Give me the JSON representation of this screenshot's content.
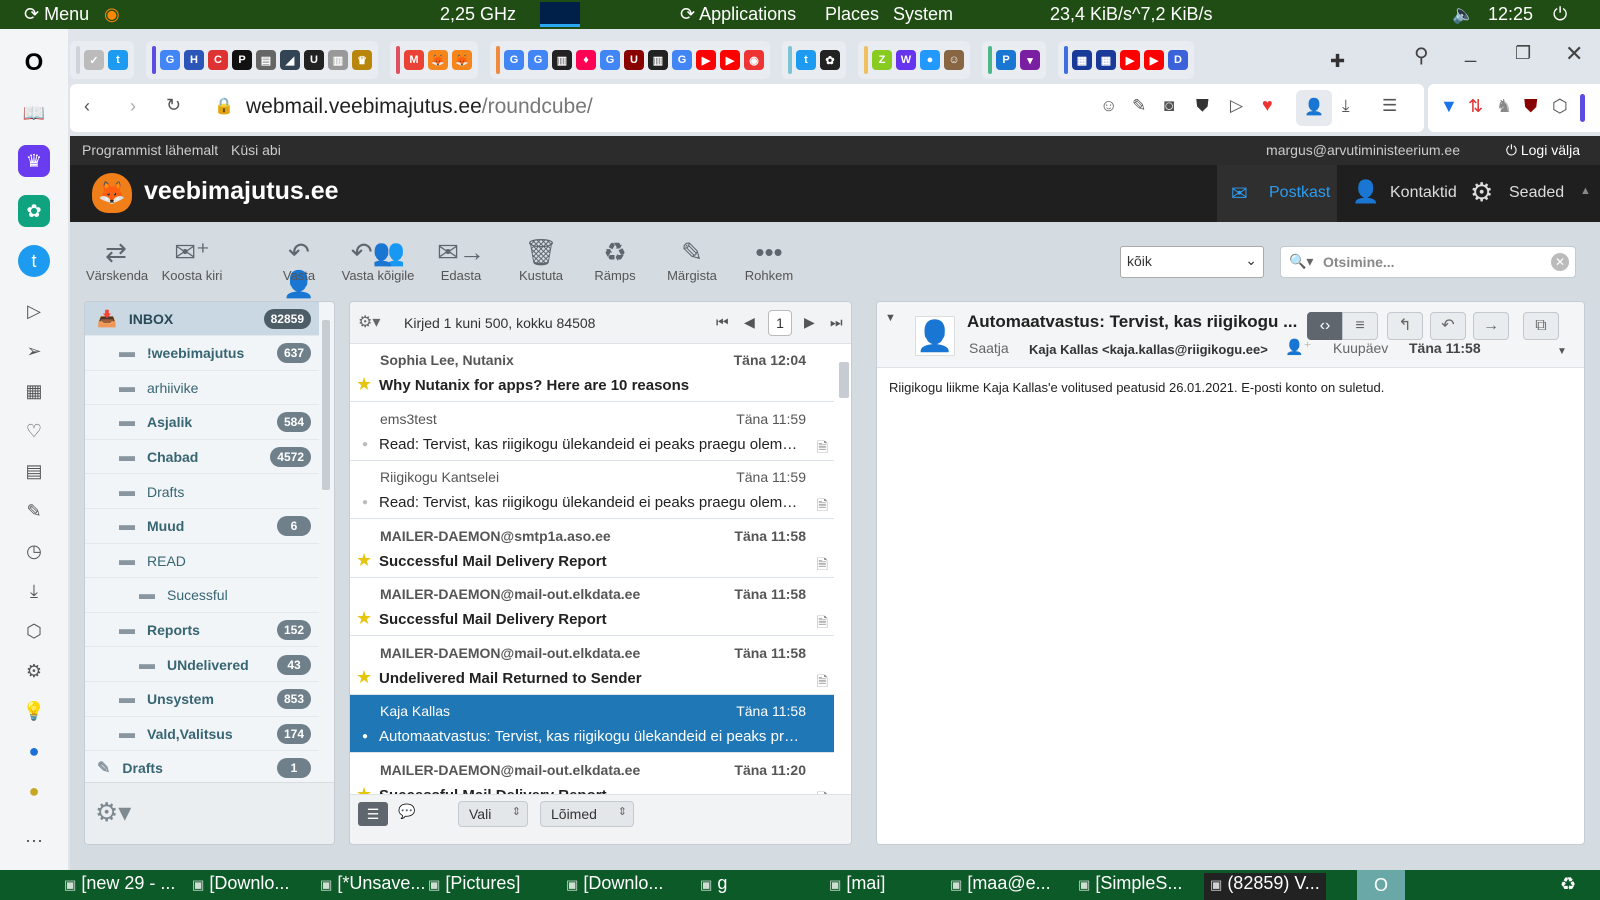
{
  "top_panel": {
    "menu": "Menu",
    "cpu": "2,25 GHz",
    "applications": "Applications",
    "places": "Places",
    "system": "System",
    "net": "23,4 KiB/s^7,2 KiB/s",
    "clock": "12:25"
  },
  "browser": {
    "url_host": "webmail.veebimajutus.ee",
    "url_path": "/roundcube/",
    "tab_groups": [
      {
        "color": "#d0d4d8",
        "favs": [
          {
            "l": "✓",
            "c": "#bbb"
          },
          {
            "l": "t",
            "c": "#1d9bf0"
          }
        ]
      },
      {
        "color": "#5b4de0",
        "favs": [
          {
            "l": "G",
            "c": "#4285f4"
          },
          {
            "l": "H",
            "c": "#2b55b8"
          },
          {
            "l": "C",
            "c": "#d33"
          },
          {
            "l": "P",
            "c": "#111"
          },
          {
            "l": "▤",
            "c": "#666"
          },
          {
            "l": "◢",
            "c": "#345"
          },
          {
            "l": "U",
            "c": "#222"
          },
          {
            "l": "▥",
            "c": "#999"
          },
          {
            "l": "♛",
            "c": "#b8860b"
          }
        ]
      },
      {
        "color": "#e0505e",
        "favs": [
          {
            "l": "M",
            "c": "#ea4335"
          },
          {
            "l": "🦊",
            "c": "#f6851b"
          },
          {
            "l": "🦊",
            "c": "#f6851b"
          }
        ]
      },
      {
        "color": "#f08a3c",
        "favs": [
          {
            "l": "G",
            "c": "#4285f4"
          },
          {
            "l": "G",
            "c": "#4285f4"
          },
          {
            "l": "▥",
            "c": "#222"
          },
          {
            "l": "♦",
            "c": "#f05"
          },
          {
            "l": "G",
            "c": "#4285f4"
          },
          {
            "l": "U",
            "c": "#800"
          },
          {
            "l": "▥",
            "c": "#222"
          },
          {
            "l": "G",
            "c": "#4285f4"
          },
          {
            "l": "▶",
            "c": "#f00"
          },
          {
            "l": "▶",
            "c": "#f00"
          },
          {
            "l": "◉",
            "c": "#e33"
          }
        ]
      },
      {
        "color": "#7cc4d4",
        "favs": [
          {
            "l": "t",
            "c": "#1d9bf0"
          },
          {
            "l": "✿",
            "c": "#222"
          }
        ]
      },
      {
        "color": "#f0c060",
        "favs": [
          {
            "l": "Z",
            "c": "#8c2"
          },
          {
            "l": "W",
            "c": "#63e"
          },
          {
            "l": "●",
            "c": "#29f"
          },
          {
            "l": "☺",
            "c": "#864"
          }
        ]
      },
      {
        "color": "#4cb88a",
        "favs": [
          {
            "l": "P",
            "c": "#1976d2"
          },
          {
            "l": "▾",
            "c": "#7b1fa2"
          }
        ]
      },
      {
        "color": "#3c6ee0",
        "favs": [
          {
            "l": "▦",
            "c": "#1a3a9a"
          },
          {
            "l": "▦",
            "c": "#1a3a9a"
          },
          {
            "l": "▶",
            "c": "#f00"
          },
          {
            "l": "▶",
            "c": "#f00"
          },
          {
            "l": "D",
            "c": "#3b62d8"
          }
        ]
      }
    ]
  },
  "roundcube": {
    "top_links": [
      "Programmist lähemalt",
      "Küsi abi"
    ],
    "user": "margus@arvutiministeerium.ee",
    "logout": "Logi välja",
    "logo": "veebimajutus.ee",
    "nav": {
      "mail": "Postkast",
      "contacts": "Kontaktid",
      "settings": "Seaded"
    },
    "toolbar": [
      "Värskenda",
      "Koosta kiri",
      "Vasta",
      "Vasta kõigile",
      "Edasta",
      "Kustuta",
      "Rämps",
      "Märgista",
      "Rohkem"
    ],
    "search_scope": "kõik",
    "search_placeholder": "Otsimine...",
    "folders": [
      {
        "name": "INBOX",
        "count": "82859",
        "level": 0
      },
      {
        "name": "!weebimajutus",
        "count": "637",
        "level": 1
      },
      {
        "name": "arhiivike",
        "count": "",
        "level": 1
      },
      {
        "name": "Asjalik",
        "count": "584",
        "level": 1
      },
      {
        "name": "Chabad",
        "count": "4572",
        "level": 1
      },
      {
        "name": "Drafts",
        "count": "",
        "level": 1
      },
      {
        "name": "Muud",
        "count": "6",
        "level": 1
      },
      {
        "name": "READ",
        "count": "",
        "level": 1
      },
      {
        "name": "Sucessful",
        "count": "",
        "level": 2
      },
      {
        "name": "Reports",
        "count": "152",
        "level": 1
      },
      {
        "name": "UNdelivered",
        "count": "43",
        "level": 2
      },
      {
        "name": "Unsystem",
        "count": "853",
        "level": 1
      },
      {
        "name": "Vald,Valitsus",
        "count": "174",
        "level": 1
      },
      {
        "name": "Drafts",
        "count": "1",
        "level": 0
      }
    ],
    "list_info": "Kirjed 1 kuni 500, kokku 84508",
    "page": "1",
    "messages": [
      {
        "from": "Sophia Lee, Nutanix",
        "date": "Täna 12:04",
        "subject": "Why Nutanix for apps? Here are 10 reasons",
        "unread": true,
        "flagged": true,
        "attach": false
      },
      {
        "from": "ems3test",
        "date": "Täna 11:59",
        "subject": "Read: Tervist, kas riigikogu ülekandeid ei peaks praegu olema mõnel teisel kanalil?",
        "unread": false,
        "flagged": false,
        "attach": true
      },
      {
        "from": "Riigikogu Kantselei",
        "date": "Täna 11:59",
        "subject": "Read: Tervist, kas riigikogu ülekandeid ei peaks praegu olema mõnel teisel kanalil?",
        "unread": false,
        "flagged": false,
        "attach": true
      },
      {
        "from": "MAILER-DAEMON@smtp1a.aso.ee",
        "date": "Täna 11:58",
        "subject": "Successful Mail Delivery Report",
        "unread": true,
        "flagged": true,
        "attach": true
      },
      {
        "from": "MAILER-DAEMON@mail-out.elkdata.ee",
        "date": "Täna 11:58",
        "subject": "Successful Mail Delivery Report",
        "unread": true,
        "flagged": true,
        "attach": true
      },
      {
        "from": "MAILER-DAEMON@mail-out.elkdata.ee",
        "date": "Täna 11:58",
        "subject": "Undelivered Mail Returned to Sender",
        "unread": true,
        "flagged": true,
        "attach": true
      },
      {
        "from": "Kaja Kallas",
        "date": "Täna 11:58",
        "subject": "Automaatvastus: Tervist, kas riigikogu ülekandeid ei peaks praegu olema mõnel teisel kanalil?",
        "unread": false,
        "flagged": false,
        "attach": false,
        "selected": true
      },
      {
        "from": "MAILER-DAEMON@mail-out.elkdata.ee",
        "date": "Täna 11:20",
        "subject": "Successful Mail Delivery Report",
        "unread": true,
        "flagged": true,
        "attach": true
      }
    ],
    "list_footer": {
      "select": "Vali",
      "threads": "Lõimed"
    },
    "preview": {
      "subject": "Automaatvastus: Tervist, kas riigikogu ...",
      "from_label": "Saatja",
      "from": "Kaja Kallas <kaja.kallas@riigikogu.ee>",
      "date_label": "Kuupäev",
      "date": "Täna 11:58",
      "body": "Riigikogu liikme Kaja Kallas'e volitused peatusid 26.01.2021. E-posti konto on suletud."
    }
  },
  "taskbar": [
    "[new 29 - ...",
    "[Downlo...",
    "[*Unsave...",
    "[Pictures]",
    "[Downlo...",
    "g",
    "[mai]",
    "[maa@e...",
    "[SimpleS...",
    "(82859) V..."
  ]
}
